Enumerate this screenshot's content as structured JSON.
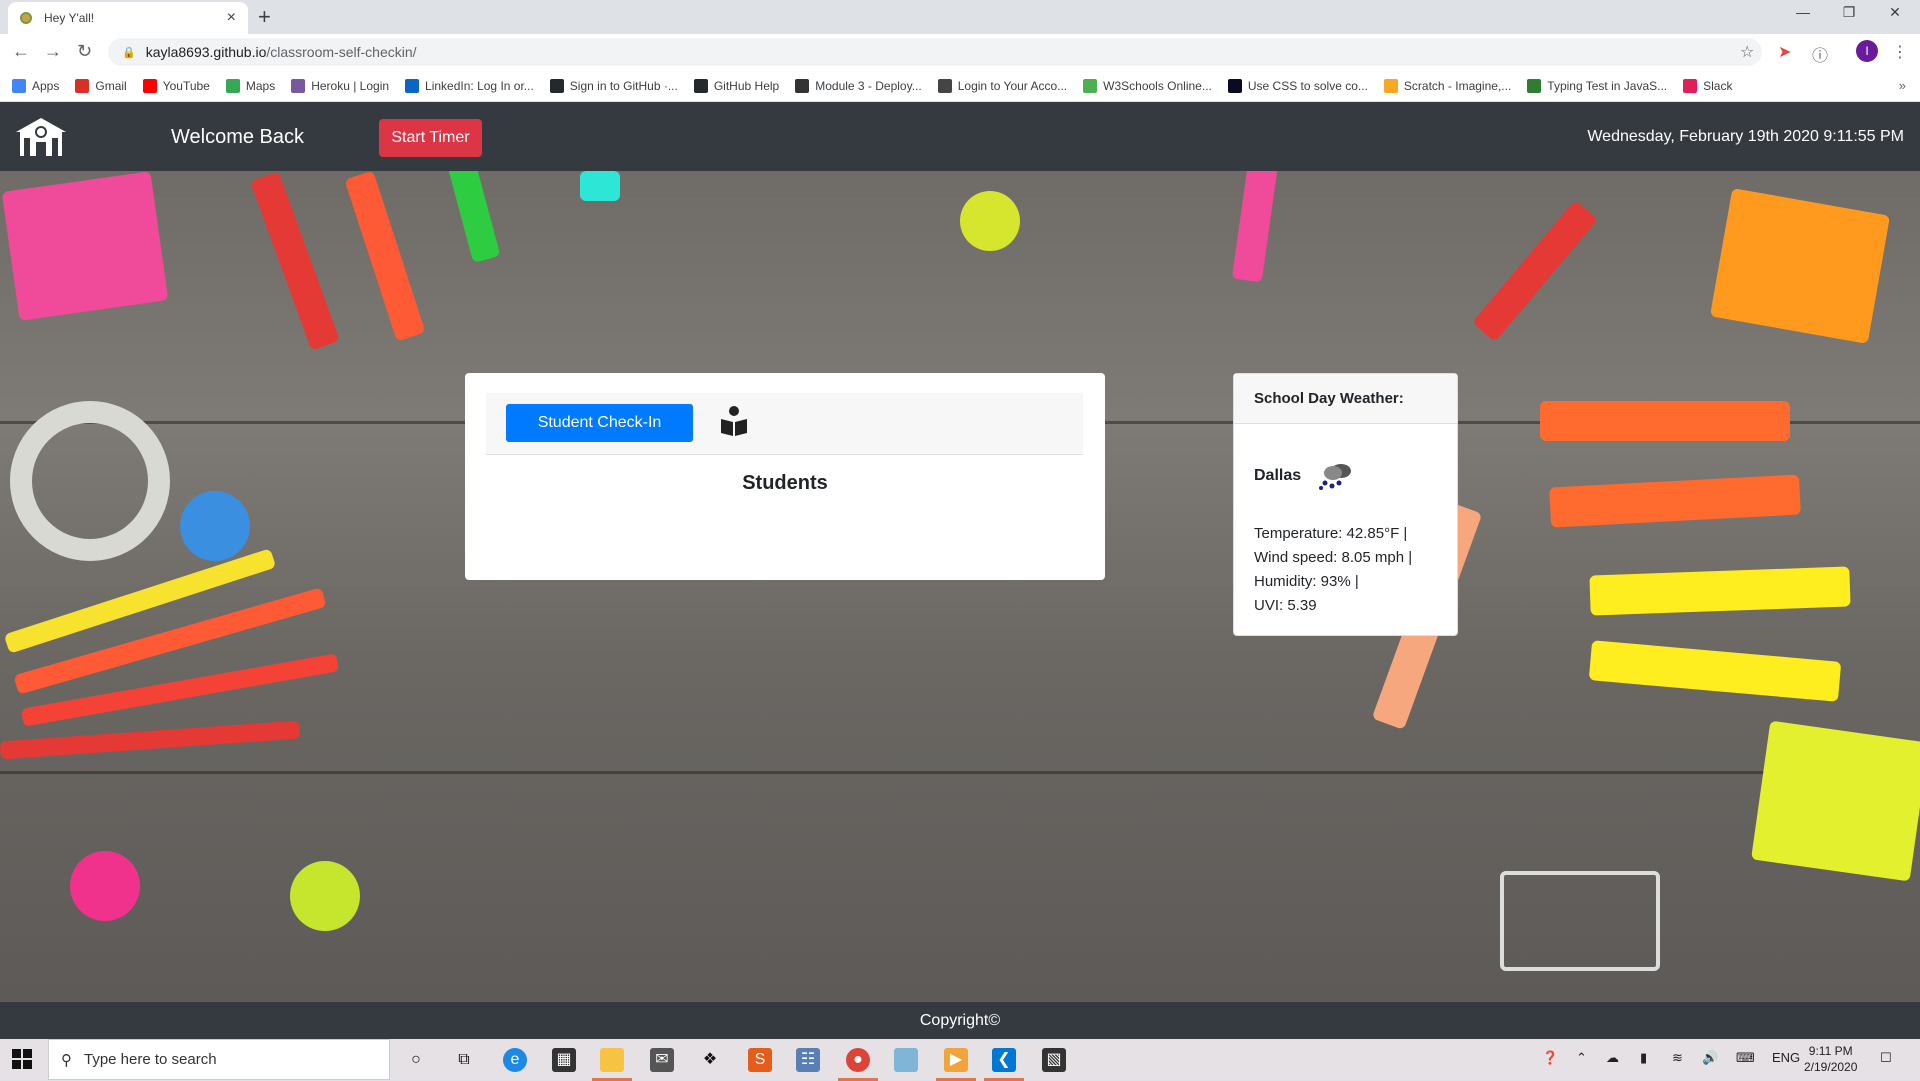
{
  "browser": {
    "tab_title": "Hey Y'all!",
    "tab_close": "×",
    "new_tab": "+",
    "url_host": "kayla8693.github.io",
    "url_path": "/classroom-self-checkin/",
    "bookmarks": [
      {
        "label": "Apps",
        "icon": "apps-grid-icon",
        "color": "#4285f4"
      },
      {
        "label": "Gmail",
        "icon": "gmail-icon",
        "color": "#d93025"
      },
      {
        "label": "YouTube",
        "icon": "youtube-icon",
        "color": "#ff0000"
      },
      {
        "label": "Maps",
        "icon": "maps-icon",
        "color": "#34a853"
      },
      {
        "label": "Heroku | Login",
        "icon": "heroku-icon",
        "color": "#79589f"
      },
      {
        "label": "LinkedIn: Log In or...",
        "icon": "linkedin-icon",
        "color": "#0a66c2"
      },
      {
        "label": "Sign in to GitHub ·...",
        "icon": "github-icon",
        "color": "#24292e"
      },
      {
        "label": "GitHub Help",
        "icon": "github-icon",
        "color": "#24292e"
      },
      {
        "label": "Module 3 - Deploy...",
        "icon": "book-icon",
        "color": "#333333"
      },
      {
        "label": "Login to Your Acco...",
        "icon": "account-icon",
        "color": "#444444"
      },
      {
        "label": "W3Schools Online...",
        "icon": "w3schools-icon",
        "color": "#4caf50"
      },
      {
        "label": "Use CSS to solve co...",
        "icon": "fcc-icon",
        "color": "#0a0a23"
      },
      {
        "label": "Scratch - Imagine,...",
        "icon": "scratch-icon",
        "color": "#f9a825"
      },
      {
        "label": "Typing Test in JavaS...",
        "icon": "typing-icon",
        "color": "#2e7d32"
      },
      {
        "label": "Slack",
        "icon": "slack-icon",
        "color": "#e01e5a"
      }
    ],
    "bookmarks_more": "»"
  },
  "header": {
    "welcome": "Welcome Back",
    "start_timer": "Start Timer",
    "datetime": "Wednesday, February 19th 2020 9:11:55 PM"
  },
  "checkin": {
    "button_label": "Student Check-In",
    "students_title": "Students"
  },
  "weather": {
    "title": "School Day Weather:",
    "city": "Dallas",
    "icon": "rain-cloud-icon",
    "lines": [
      "Temperature: 42.85°F |",
      "Wind speed: 8.05 mph |",
      "Humidity: 93% |",
      "UVI: 5.39"
    ]
  },
  "footer": {
    "text": "Copyright©"
  },
  "taskbar": {
    "search_placeholder": "Type here to search",
    "lang": "ENG",
    "time": "9:11 PM",
    "date": "2/19/2020"
  },
  "colors": {
    "header_bg": "#343a40",
    "timer_red": "#dc3545",
    "primary_blue": "#007bff"
  }
}
